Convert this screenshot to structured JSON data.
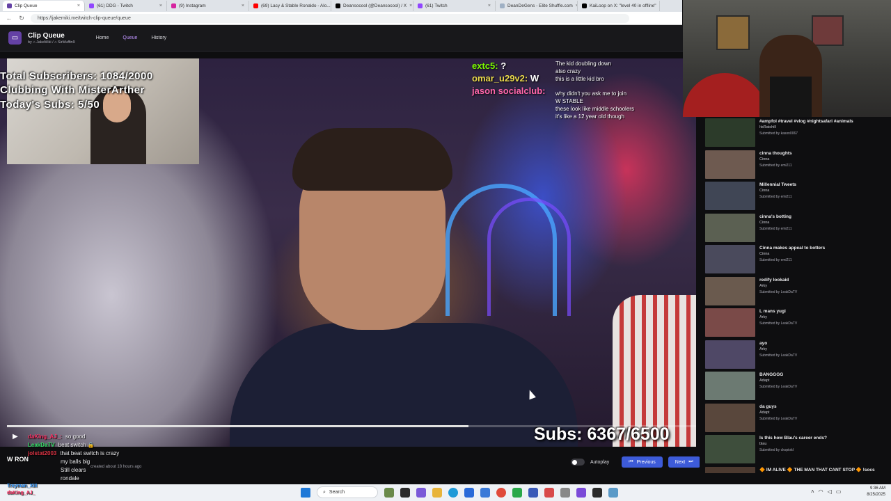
{
  "browser": {
    "tabs": [
      {
        "label": "Clip Queue",
        "color": "#6441a5"
      },
      {
        "label": "(61) DDG - Twitch",
        "color": "#9146ff"
      },
      {
        "label": "(9) Instagram",
        "color": "#d6249f"
      },
      {
        "label": "(69) Lacy & Stable Ronaldo - Alo...",
        "color": "#ff0000"
      },
      {
        "label": "Deansocool (@Deansocool) / X",
        "color": "#000000"
      },
      {
        "label": "(61) Twitch",
        "color": "#9146ff"
      },
      {
        "label": "DeanDeGens - Elite Shuffle.com",
        "color": "#e9eef3"
      },
      {
        "label": "KaiLoop on X: \"level 40 in offline\"",
        "color": "#000000"
      }
    ],
    "url": "https://jakemiki.me/twitch-clip-queue/queue"
  },
  "app": {
    "title": "Clip Queue",
    "byline": "by ⌂ JakeMiki / ⌂ SirMuffin9",
    "nav": [
      {
        "label": "Home"
      },
      {
        "label": "Queue"
      },
      {
        "label": "History"
      }
    ]
  },
  "overlay": {
    "total_subs": "Total Subscribers: 1084/2000",
    "clubbing": "Clubbing With MisterArther",
    "today_subs": "Today's Subs: 5/50",
    "subs_big": "Subs: 6367/6500",
    "progress": 0.67
  },
  "video_chat": [
    {
      "name": "extc5:",
      "text": "?",
      "color": "#7cfc00",
      "big": true
    },
    {
      "name": "omar_u29v2:",
      "text": "W",
      "color": "#e8d84b",
      "big": true
    },
    {
      "name": "jason socialclub:",
      "text": "",
      "color": "#ff66aa",
      "big": true
    },
    {
      "name": "",
      "text": "The kid doubling down",
      "color": "#ffffff",
      "big": false
    },
    {
      "name": "",
      "text": "also crazy",
      "color": "#ffffff",
      "big": false
    },
    {
      "name": "",
      "text": "this is a little kid bro",
      "color": "#ffffff",
      "big": false
    },
    {
      "name": "",
      "text": "why didn't you ask me to join",
      "color": "#ffffff",
      "big": false
    },
    {
      "name": "",
      "text": "W STABLE",
      "color": "#ffffff",
      "big": false
    },
    {
      "name": "",
      "text": "these look like middle schoolers",
      "color": "#ffffff",
      "big": false
    },
    {
      "name": "",
      "text": "it's like a 12 year old though",
      "color": "#ffffff",
      "big": false
    }
  ],
  "bottom_chat": [
    {
      "name": "daKing_AJ_:",
      "text": "so good",
      "color": "#ff3366"
    },
    {
      "name": "LeakDaTV",
      "text": "beat switch 🔒",
      "color": "#33dd66"
    },
    {
      "name": "jolstat2003",
      "text": "that beat switch is crazy",
      "color": "#dd3344"
    },
    {
      "name": "",
      "text": "my balls big",
      "color": "#ffffff"
    },
    {
      "name": "",
      "text": "Still clears",
      "color": "#ffffff"
    },
    {
      "name": "",
      "text": "rondale",
      "color": "#ffffff"
    },
    {
      "name": "Treyman_XIII",
      "text": "",
      "color": "#3399ff"
    },
    {
      "name": "daKing_AJ_",
      "text": "",
      "color": "#ff3366"
    }
  ],
  "wron": "W RON",
  "created": "created about 18 hours ago",
  "controls": {
    "autoplay": "Autoplay",
    "previous": "Previous",
    "next": "Next"
  },
  "queue": [
    {
      "title": "#ampfol #travel #vlog #nightsafari #animals",
      "channel": "ItsRatchill",
      "submitted": "Submitted by kason0067",
      "color": "#2c3b2a"
    },
    {
      "title": "cinna thoughts",
      "channel": "Cinna",
      "submitted": "Submitted by emi211",
      "color": "#6e5a50"
    },
    {
      "title": "Millennial Tweets",
      "channel": "Cinna",
      "submitted": "Submitted by emi211",
      "color": "#404655"
    },
    {
      "title": "cinna's botting",
      "channel": "Cinna",
      "submitted": "Submitted by emi211",
      "color": "#5b6052"
    },
    {
      "title": "Cinna makes appeal to botters",
      "channel": "Cinna",
      "submitted": "Submitted by emi211",
      "color": "#4a4a5c"
    },
    {
      "title": "redify lookaid",
      "channel": "Arky",
      "submitted": "Submitted by LeakDaTV",
      "color": "#6a5a4e"
    },
    {
      "title": "L mans yugi",
      "channel": "Arky",
      "submitted": "Submitted by LeakDaTV",
      "color": "#7a4a48"
    },
    {
      "title": "ayo",
      "channel": "Arky",
      "submitted": "Submitted by LeakDaTV",
      "color": "#4f4866"
    },
    {
      "title": "BANGGGG",
      "channel": "Adapt",
      "submitted": "Submitted by LeakDaTV",
      "color": "#6c7a72"
    },
    {
      "title": "da guys",
      "channel": "Adapt",
      "submitted": "Submitted by LeakDaTV",
      "color": "#59473c"
    },
    {
      "title": "Is this how Blau's career ends?",
      "channel": "blau",
      "submitted": "Submitted by ckopiold",
      "color": "#3e4e3c"
    },
    {
      "title": "🔶 IM ALIVE 🔶 THE MAN THAT CANT STOP 🔶 !socs !comm !socials !po",
      "channel": "",
      "submitted": "",
      "color": "#4c3a30"
    }
  ],
  "taskbar": {
    "search": "Search",
    "time": "9:36 AM",
    "date": "8/25/2025"
  }
}
